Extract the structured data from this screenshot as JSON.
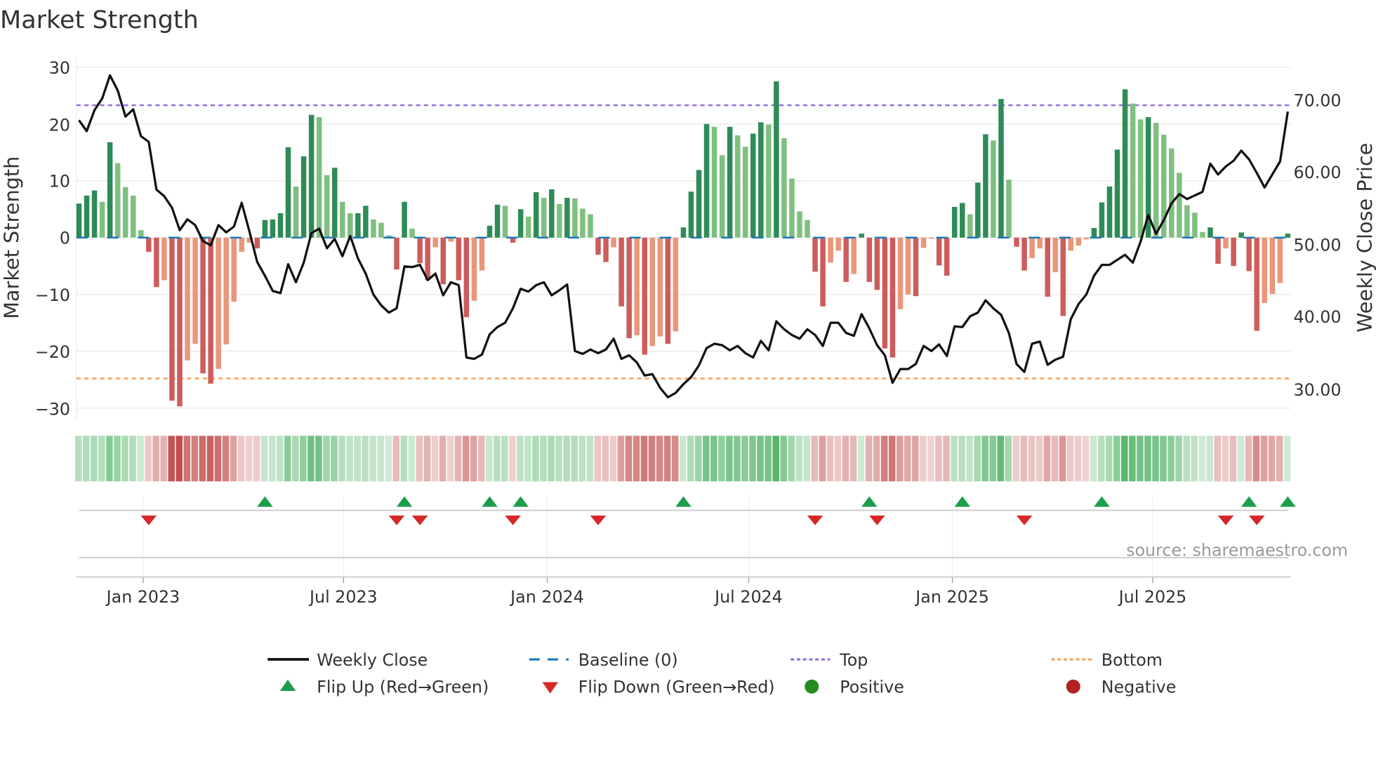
{
  "chart_data": {
    "type": "bar",
    "title": "Market Strength",
    "ylabel": "Market Strength",
    "ylabel_right": "Weekly Close Price",
    "ylim": [
      -32,
      32
    ],
    "ylim_right": [
      25.5,
      75.5
    ],
    "start_date": "2022-11-04",
    "frequency": "weekly",
    "grid": true,
    "top_threshold": 23.3,
    "bottom_threshold": -24.8,
    "y_ticks": [
      "30",
      "20",
      "10",
      "0",
      "−10",
      "−20",
      "−30"
    ],
    "y_tick_values": [
      30,
      20,
      10,
      0,
      -10,
      -20,
      -30
    ],
    "y_right_ticks": [
      "70.00",
      "60.00",
      "50.00",
      "40.00",
      "30.00"
    ],
    "y_right_tick_values": [
      70,
      60,
      50,
      40,
      30
    ],
    "x_ticks": [
      "Jan 2023",
      "Jul 2023",
      "Jan 2024",
      "Jul 2024",
      "Jan 2025",
      "Jul 2025"
    ],
    "x_tick_dates": [
      "2023-01-01",
      "2023-07-01",
      "2024-01-01",
      "2024-07-01",
      "2025-01-01",
      "2025-07-01"
    ],
    "strength": [
      6.0,
      7.4,
      8.3,
      6.3,
      16.8,
      13.1,
      8.9,
      7.4,
      1.3,
      -2.5,
      -8.7,
      -7.5,
      -28.7,
      -29.7,
      -21.6,
      -18.7,
      -23.9,
      -25.7,
      -23.1,
      -18.8,
      -11.3,
      -2.5,
      -0.9,
      -1.9,
      3.1,
      3.2,
      4.3,
      15.9,
      9.0,
      14.3,
      21.6,
      21.2,
      11.0,
      12.3,
      6.3,
      4.3,
      4.3,
      5.6,
      3.2,
      2.6,
      0.4,
      -5.6,
      6.3,
      1.6,
      -4.5,
      -7.5,
      -1.7,
      -8.2,
      -0.7,
      -7.5,
      -14.0,
      -11.1,
      -5.8,
      2.1,
      5.8,
      5.6,
      -0.9,
      5.0,
      3.7,
      8.0,
      7.0,
      8.5,
      5.9,
      7.0,
      6.9,
      5.1,
      4.1,
      -3.0,
      -4.3,
      -1.7,
      -12.1,
      -17.7,
      -17.2,
      -20.6,
      -19.1,
      -17.4,
      -18.7,
      -16.5,
      1.8,
      8.1,
      11.9,
      20.0,
      19.5,
      14.5,
      19.5,
      18.0,
      16.0,
      18.3,
      20.3,
      19.9,
      27.5,
      17.5,
      10.4,
      4.6,
      3.1,
      -6.0,
      -12.1,
      -4.4,
      -2.3,
      -7.8,
      -6.4,
      0.7,
      -7.8,
      -9.2,
      -19.5,
      -21.1,
      -12.6,
      -10.0,
      -10.3,
      -1.8,
      -0.2,
      -4.9,
      -6.7,
      5.4,
      6.1,
      4.1,
      9.7,
      18.2,
      17.1,
      24.4,
      10.2,
      -1.6,
      -5.8,
      -3.6,
      -1.9,
      -10.4,
      -6.1,
      -13.8,
      -2.3,
      -1.4,
      -0.3,
      1.7,
      6.2,
      9.0,
      15.5,
      26.1,
      23.6,
      20.8,
      21.2,
      20.2,
      18.1,
      15.7,
      11.4,
      5.7,
      4.4,
      1.0,
      1.8,
      -4.6,
      -1.9,
      -5.0,
      0.9,
      -5.9,
      -16.4,
      -11.5,
      -9.9,
      -8.0,
      0.7
    ],
    "weekly_close": [
      67.2,
      65.7,
      68.6,
      70.2,
      73.4,
      71.3,
      67.7,
      68.7,
      65.0,
      64.2,
      57.6,
      56.7,
      55.1,
      52.0,
      53.5,
      52.7,
      50.5,
      49.9,
      52.7,
      51.7,
      52.5,
      55.8,
      51.8,
      47.6,
      45.7,
      43.6,
      43.3,
      47.3,
      44.8,
      47.5,
      51.6,
      52.2,
      49.5,
      50.8,
      48.4,
      51.2,
      48.1,
      46.0,
      43.1,
      41.6,
      40.6,
      41.2,
      47.0,
      46.9,
      47.2,
      45.1,
      46.0,
      43.0,
      44.8,
      44.4,
      34.4,
      34.2,
      34.8,
      37.6,
      38.6,
      39.2,
      41.2,
      43.9,
      43.5,
      44.4,
      44.8,
      43.0,
      43.7,
      44.5,
      35.3,
      34.9,
      35.5,
      35.0,
      35.5,
      37.0,
      34.2,
      34.7,
      33.7,
      31.9,
      32.1,
      30.2,
      28.9,
      29.5,
      30.7,
      31.7,
      33.3,
      35.7,
      36.3,
      36.1,
      35.4,
      36.0,
      35.0,
      34.4,
      36.7,
      35.4,
      39.4,
      38.3,
      37.5,
      37.0,
      38.3,
      37.5,
      36.0,
      39.2,
      39.2,
      37.8,
      37.4,
      40.4,
      38.4,
      36.1,
      34.7,
      30.9,
      32.8,
      32.8,
      33.5,
      36.0,
      35.3,
      36.2,
      34.6,
      38.7,
      38.6,
      40.1,
      40.6,
      42.3,
      41.2,
      40.3,
      37.8,
      33.5,
      32.4,
      36.3,
      36.6,
      33.4,
      34.1,
      34.5,
      39.7,
      41.8,
      43.1,
      45.7,
      47.2,
      47.2,
      47.9,
      48.6,
      47.5,
      50.4,
      54.1,
      51.5,
      53.4,
      55.7,
      57.0,
      56.3,
      56.8,
      57.3,
      61.2,
      59.7,
      60.8,
      61.6,
      63.0,
      61.8,
      59.9,
      57.9,
      59.7,
      61.5,
      68.4
    ],
    "flip_up_weeks": [
      24,
      42,
      53,
      57,
      78,
      102,
      114,
      132,
      151,
      156
    ],
    "flip_down_weeks": [
      9,
      41,
      44,
      56,
      67,
      95,
      103,
      122,
      148,
      152
    ],
    "legend": {
      "placement": "bottom",
      "entries": [
        "Weekly Close",
        "Baseline (0)",
        "Top",
        "Bottom",
        "Flip Up (Red→Green)",
        "Flip Down (Green→Red)",
        "Positive",
        "Negative"
      ]
    },
    "annotation": "source: sharemaestro.com",
    "colors": {
      "rising_positive": "#2e8b57",
      "falling_positive": "#7fbf7f",
      "falling_negative": "#cd5c5c",
      "rising_negative": "#e9967a",
      "baseline": "#1f77b4",
      "top": "#9370db",
      "bottom": "#f4a460",
      "line": "#111111",
      "flip_up": "#1a9e4a",
      "flip_down": "#d62728",
      "positive": "#228b22",
      "negative": "#b22222",
      "heat_positive": "#4caf60",
      "heat_negative": "#c0504d"
    }
  }
}
